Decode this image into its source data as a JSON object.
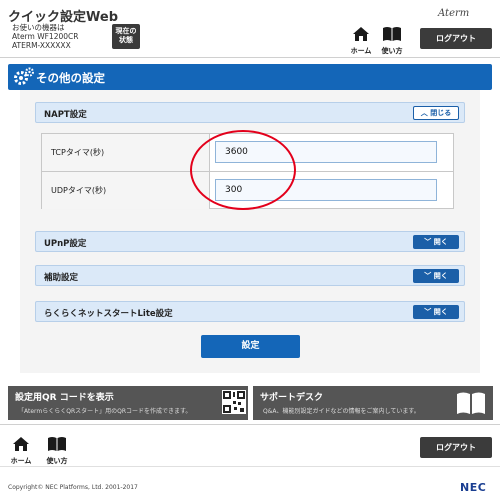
{
  "header": {
    "title": "クイック設定Web",
    "device_label": "お使いの機器は",
    "device_model": "Aterm WF1200CR",
    "device_id": "ATERM-XXXXXX",
    "current_state_line1": "現在の",
    "current_state_line2": "状態",
    "brand": "Aterm",
    "home_label": "ホーム",
    "help_label": "使い方",
    "logout_label": "ログアウト"
  },
  "page": {
    "title": "その他の設定"
  },
  "sections": {
    "napt": {
      "label": "NAPT設定",
      "toggle_label": "閉じる"
    },
    "upnp": {
      "label": "UPnP設定",
      "toggle_label": "開く"
    },
    "assist": {
      "label": "補助設定",
      "toggle_label": "開く"
    },
    "rakuraku": {
      "label": "らくらくネットスタートLite設定",
      "toggle_label": "開く"
    }
  },
  "napt_fields": {
    "tcp_label": "TCPタイマ(秒)",
    "tcp_value": "3600",
    "udp_label": "UDPタイマ(秒)",
    "udp_value": "300"
  },
  "apply_label": "設定",
  "cards": {
    "qr": {
      "title": "設定用QR コードを表示",
      "desc": "「AtermらくらくQRスタート」用のQRコードを作成できます。"
    },
    "support": {
      "title": "サポートデスク",
      "desc": "Q&A、機能別設定ガイドなどの情報をご案内しています。"
    }
  },
  "footer": {
    "home_label": "ホーム",
    "help_label": "使い方",
    "logout_label": "ログアウト",
    "copyright": "Copyright© NEC Platforms, Ltd. 2001-2017",
    "brand": "NEC"
  },
  "colors": {
    "accent": "#1466b8",
    "highlight": "#e3001b"
  }
}
